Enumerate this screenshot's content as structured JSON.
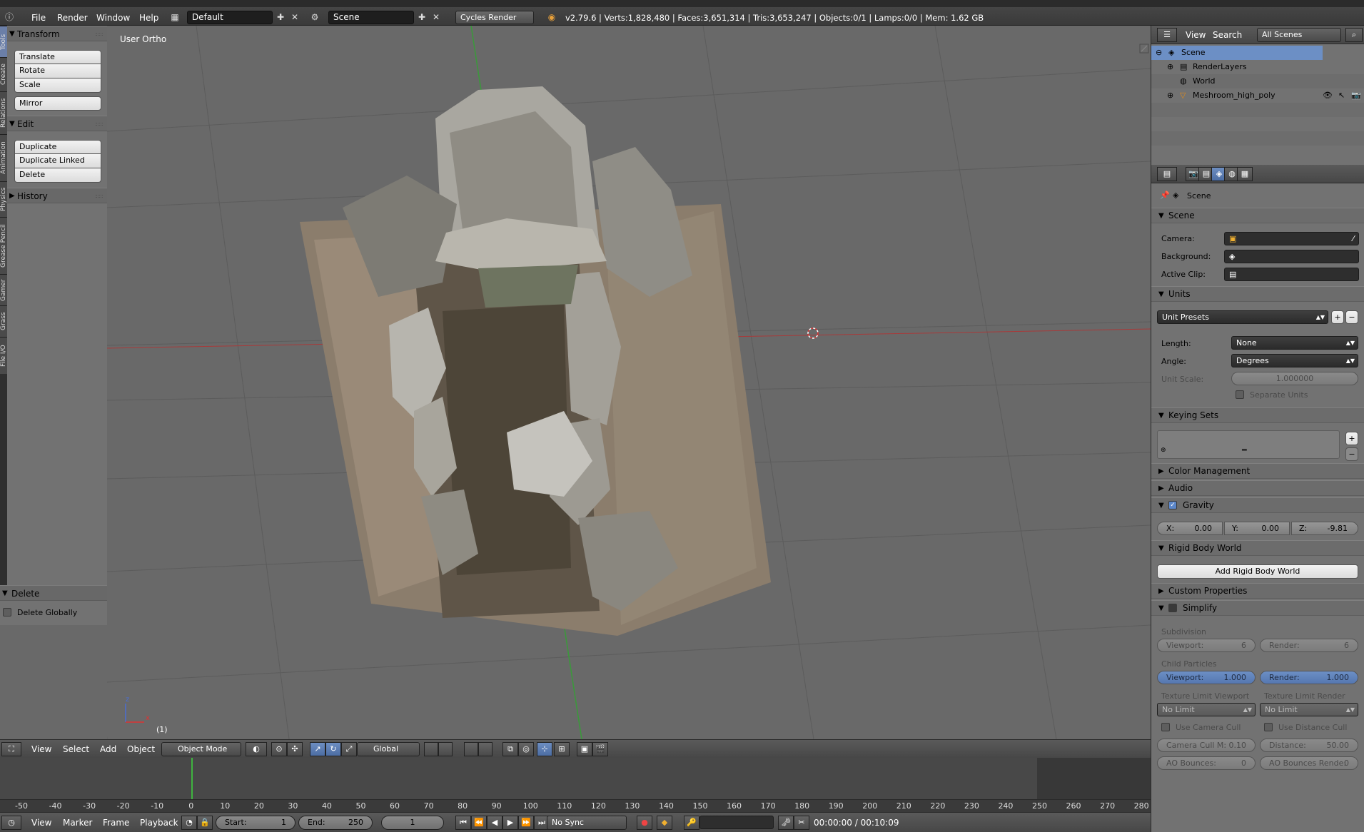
{
  "topbar": {
    "menus": [
      "File",
      "Render",
      "Window",
      "Help"
    ],
    "screen_layout": "Default",
    "scene": "Scene",
    "render_engine": "Cycles Render",
    "stats": "v2.79.6 | Verts:1,828,480 | Faces:3,651,314 | Tris:3,653,247 | Objects:0/1 | Lamps:0/0 | Mem: 1.62 GB"
  },
  "vtabs": [
    "Tools",
    "Create",
    "Relations",
    "Animation",
    "Physics",
    "Grease Pencil",
    "Gamer",
    "Grass",
    "File I/O"
  ],
  "toolshelf": {
    "transform": {
      "title": "Transform",
      "buttons": [
        "Translate",
        "Rotate",
        "Scale",
        "Mirror"
      ]
    },
    "edit": {
      "title": "Edit",
      "buttons": [
        "Duplicate",
        "Duplicate Linked",
        "Delete"
      ]
    },
    "history": {
      "title": "History"
    }
  },
  "operator_panel": {
    "title": "Delete",
    "checkbox_label": "Delete Globally"
  },
  "viewport": {
    "view_label": "User Ortho",
    "frame_label": "(1)",
    "axis_z": "z",
    "axis_x": "x"
  },
  "viewport_header": {
    "menus": [
      "View",
      "Select",
      "Add",
      "Object"
    ],
    "mode": "Object Mode",
    "orientation": "Global"
  },
  "timeline": {
    "ticks": [
      "-50",
      "-40",
      "-30",
      "-20",
      "-10",
      "0",
      "10",
      "20",
      "30",
      "40",
      "50",
      "60",
      "70",
      "80",
      "90",
      "100",
      "110",
      "120",
      "130",
      "140",
      "150",
      "160",
      "170",
      "180",
      "190",
      "200",
      "210",
      "220",
      "230",
      "240",
      "250",
      "260",
      "270",
      "280"
    ]
  },
  "timeline_header": {
    "menus": [
      "View",
      "Marker",
      "Frame",
      "Playback"
    ],
    "start_label": "Start:",
    "start_value": "1",
    "end_label": "End:",
    "end_value": "250",
    "current_frame": "1",
    "sync": "No Sync",
    "time": "00:00:00 / 00:10:09"
  },
  "outliner": {
    "menus": [
      "View",
      "Search"
    ],
    "display_mode": "All Scenes",
    "items": [
      "Scene",
      "RenderLayers",
      "World",
      "Meshroom_high_poly"
    ]
  },
  "properties": {
    "context": "Scene",
    "scene_panel": {
      "title": "Scene",
      "camera_label": "Camera:",
      "background_label": "Background:",
      "clip_label": "Active Clip:"
    },
    "units": {
      "title": "Units",
      "presets": "Unit Presets",
      "length_label": "Length:",
      "length_value": "None",
      "angle_label": "Angle:",
      "angle_value": "Degrees",
      "scale_label": "Unit Scale:",
      "scale_value": "1.000000",
      "separate_label": "Separate Units"
    },
    "keying_sets": {
      "title": "Keying Sets"
    },
    "color_management": "Color Management",
    "audio": "Audio",
    "gravity": {
      "title": "Gravity",
      "x_label": "X:",
      "x_value": "0.00",
      "y_label": "Y:",
      "y_value": "0.00",
      "z_label": "Z:",
      "z_value": "-9.81"
    },
    "rigid_body": {
      "title": "Rigid Body World",
      "button": "Add Rigid Body World"
    },
    "custom_properties": "Custom Properties",
    "simplify": {
      "title": "Simplify",
      "subdivision_label": "Subdivision",
      "viewport_label": "Viewport:",
      "viewport_sub": "6",
      "render_label": "Render:",
      "render_sub": "6",
      "child_particles_label": "Child Particles",
      "viewport_cp": "1.000",
      "render_cp": "1.000",
      "tex_viewport_label": "Texture Limit Viewport",
      "tex_render_label": "Texture Limit Render",
      "tex_viewport_value": "No Limit",
      "tex_render_value": "No Limit",
      "camera_cull_label": "Use Camera Cull",
      "distance_cull_label": "Use Distance Cull",
      "camera_cull_m_label": "Camera Cull M:",
      "camera_cull_m_value": "0.10",
      "distance_label": "Distance:",
      "distance_value": "50.00",
      "ao_bounces_label": "AO Bounces:",
      "ao_bounces_value": "0",
      "ao_render_label": "AO Bounces Rende:",
      "ao_render_value": "0"
    }
  }
}
